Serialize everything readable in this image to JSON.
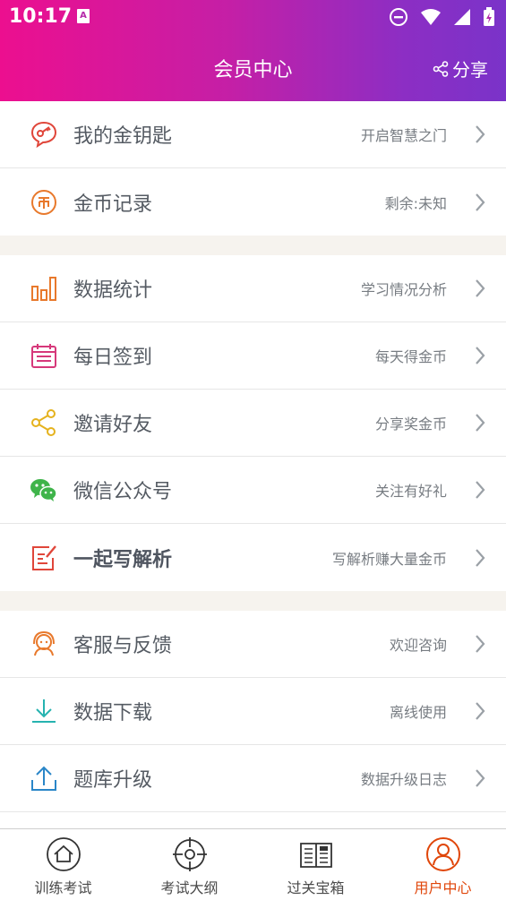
{
  "status": {
    "time": "10:17",
    "app_badge": "A"
  },
  "nav": {
    "title": "会员中心",
    "share_label": "分享"
  },
  "groups": [
    [
      {
        "icon": "key-chat-icon",
        "label": "我的金钥匙",
        "sub": "开启智慧之门",
        "bold": false
      },
      {
        "icon": "coin-icon",
        "label": "金币记录",
        "sub": "剩余:未知",
        "bold": false
      }
    ],
    [
      {
        "icon": "bar-chart-icon",
        "label": "数据统计",
        "sub": "学习情况分析",
        "bold": false
      },
      {
        "icon": "calendar-icon",
        "label": "每日签到",
        "sub": "每天得金币",
        "bold": false
      },
      {
        "icon": "share-icon",
        "label": "邀请好友",
        "sub": "分享奖金币",
        "bold": false
      },
      {
        "icon": "wechat-icon",
        "label": "微信公众号",
        "sub": "关注有好礼",
        "bold": false
      },
      {
        "icon": "write-icon",
        "label": "一起写解析",
        "sub": "写解析赚大量金币",
        "bold": true
      }
    ],
    [
      {
        "icon": "customer-service-icon",
        "label": "客服与反馈",
        "sub": "欢迎咨询",
        "bold": false
      },
      {
        "icon": "download-icon",
        "label": "数据下载",
        "sub": "离线使用",
        "bold": false
      },
      {
        "icon": "upload-icon",
        "label": "题库升级",
        "sub": "数据升级日志",
        "bold": false
      }
    ]
  ],
  "tabs": [
    {
      "icon": "home-icon",
      "label": "训练考试",
      "active": false
    },
    {
      "icon": "target-icon",
      "label": "考试大纲",
      "active": false
    },
    {
      "icon": "newspaper-icon",
      "label": "过关宝箱",
      "active": false
    },
    {
      "icon": "user-icon",
      "label": "用户中心",
      "active": true
    }
  ],
  "colors": {
    "header_start": "#ec0f8f",
    "header_end": "#7a33c9",
    "active_tab": "#e0460a",
    "section_gap": "#f6f3ee"
  }
}
